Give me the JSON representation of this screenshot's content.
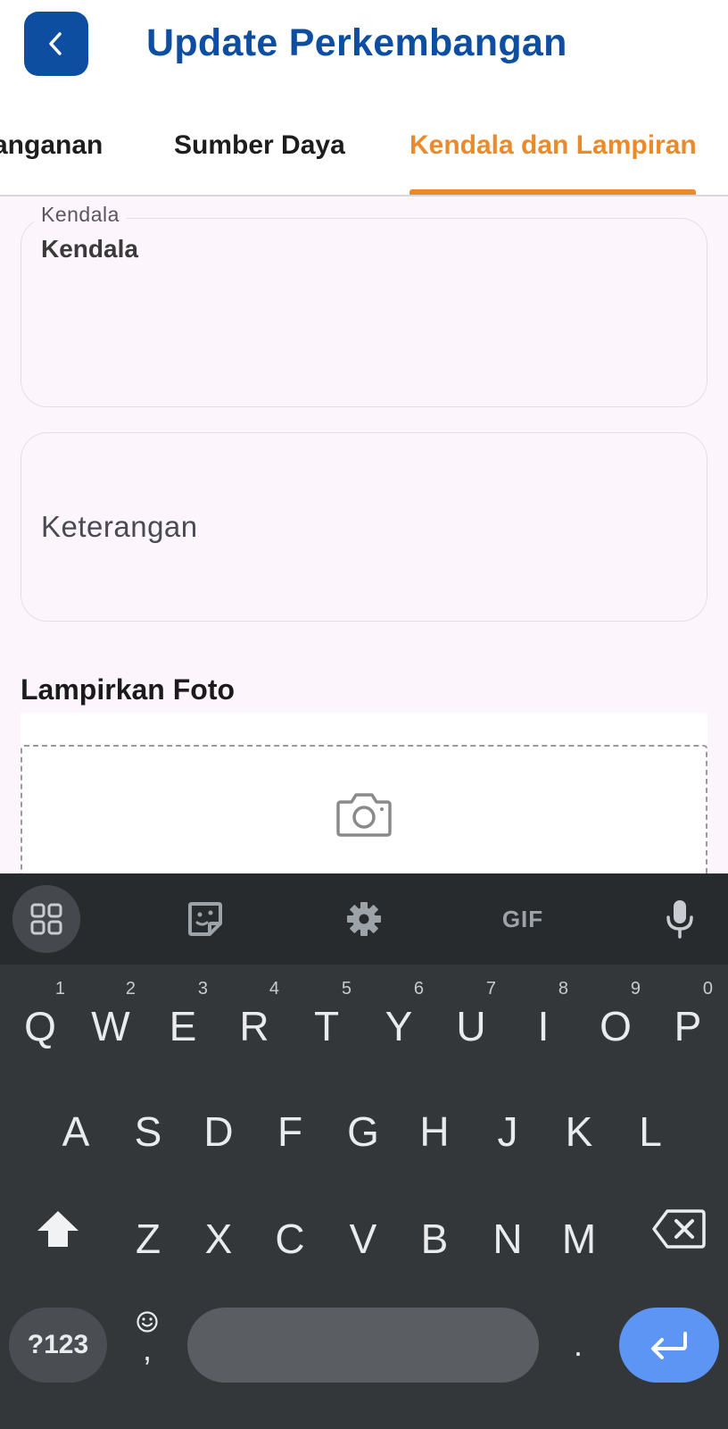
{
  "header": {
    "title": "Update Perkembangan"
  },
  "tabs": [
    {
      "label": "anganan"
    },
    {
      "label": "Sumber Daya"
    },
    {
      "label": "Kendala dan Lampiran",
      "active": true
    }
  ],
  "form": {
    "kendala": {
      "label": "Kendala",
      "value": "Kendala"
    },
    "keterangan": {
      "placeholder": "Keterangan"
    },
    "photo_section_title": "Lampirkan Foto"
  },
  "keyboard": {
    "toolbar": {
      "gif_label": "GIF"
    },
    "row1": [
      {
        "k": "Q",
        "n": "1"
      },
      {
        "k": "W",
        "n": "2"
      },
      {
        "k": "E",
        "n": "3"
      },
      {
        "k": "R",
        "n": "4"
      },
      {
        "k": "T",
        "n": "5"
      },
      {
        "k": "Y",
        "n": "6"
      },
      {
        "k": "U",
        "n": "7"
      },
      {
        "k": "I",
        "n": "8"
      },
      {
        "k": "O",
        "n": "9"
      },
      {
        "k": "P",
        "n": "0"
      }
    ],
    "row2": [
      "A",
      "S",
      "D",
      "F",
      "G",
      "H",
      "J",
      "K",
      "L"
    ],
    "row3": [
      "Z",
      "X",
      "C",
      "V",
      "B",
      "N",
      "M"
    ],
    "symbols_label": "?123",
    "comma": ",",
    "period": "."
  },
  "colors": {
    "brand_blue": "#0e4ea1",
    "accent_orange": "#ea8a2a",
    "enter_blue": "#5c95f3"
  }
}
